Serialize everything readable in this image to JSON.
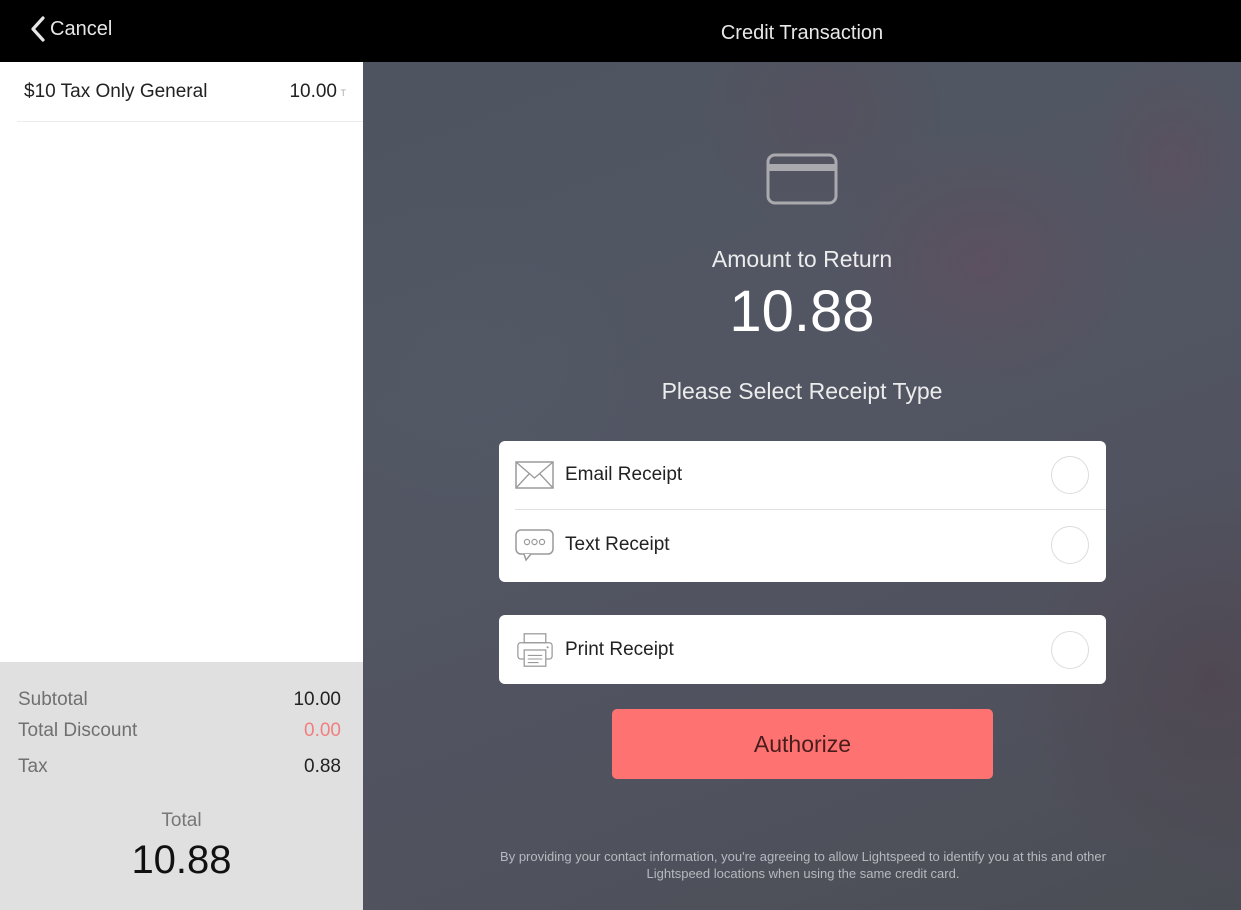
{
  "header": {
    "cancel_label": "Cancel",
    "title": "Credit Transaction"
  },
  "cart": {
    "items": [
      {
        "name": "$10 Tax Only General",
        "price": "10.00",
        "tax_flag": "T"
      }
    ]
  },
  "totals": {
    "subtotal_label": "Subtotal",
    "subtotal_value": "10.00",
    "discount_label": "Total Discount",
    "discount_value": "0.00",
    "tax_label": "Tax",
    "tax_value": "0.88",
    "total_label": "Total",
    "total_value": "10.88"
  },
  "payment": {
    "icon": "credit-card-icon",
    "amount_label": "Amount to Return",
    "amount_value": "10.88",
    "receipt_prompt": "Please Select Receipt Type",
    "receipt_options": [
      {
        "label": "Email Receipt",
        "icon": "envelope-icon",
        "selected": false
      },
      {
        "label": "Text Receipt",
        "icon": "chat-bubble-icon",
        "selected": false
      },
      {
        "label": "Print Receipt",
        "icon": "printer-icon",
        "selected": false
      }
    ],
    "authorize_label": "Authorize",
    "disclaimer": "By providing your contact information, you're agreeing to allow Lightspeed to identify you at this and other Lightspeed locations when using the same credit card."
  },
  "colors": {
    "authorize_bg": "#ff7272",
    "discount_text": "#f07f7f",
    "totals_bg": "#e0e0e1"
  }
}
